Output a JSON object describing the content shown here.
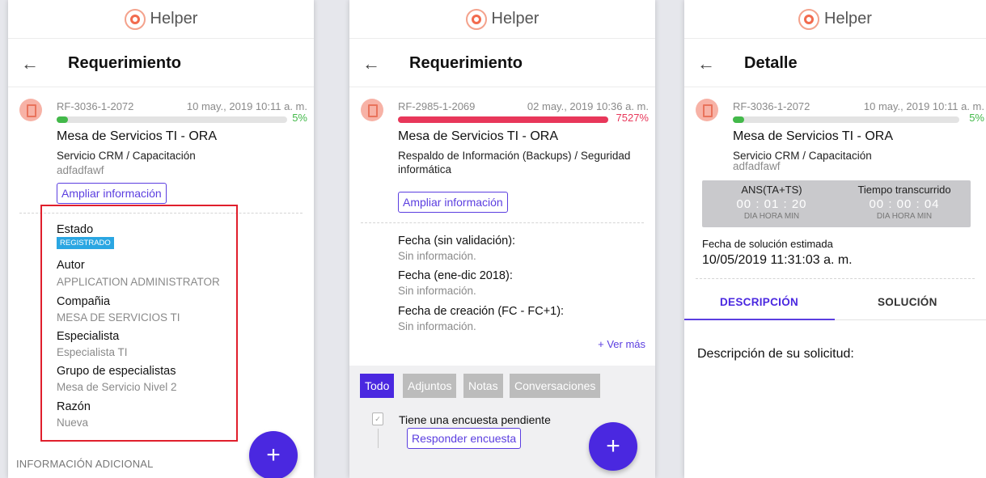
{
  "app": {
    "name": "Helper"
  },
  "colors": {
    "accent": "#4a28e0",
    "progress_green": "#43b94a",
    "progress_red": "#e8375a",
    "badge_blue": "#2aa6e2",
    "highlight_box": "#e01f2c"
  },
  "screen1": {
    "title": "Requerimiento",
    "request_id": "RF-3036-1-2072",
    "date": "10 may., 2019 10:11 a. m.",
    "progress_percent": 5,
    "progress_label": "5%",
    "service_desk": "Mesa de Servicios TI - ORA",
    "category": "Servicio CRM / Capacitación",
    "description": "adfadfawf",
    "expand_button": "Ampliar información",
    "fields": {
      "estado_label": "Estado",
      "estado_badge": "REGISTRADO",
      "autor_label": "Autor",
      "autor_value": "APPLICATION ADMINISTRATOR",
      "compania_label": "Compañia",
      "compania_value": "MESA DE SERVICIOS TI",
      "especialista_label": "Especialista",
      "especialista_value": "Especialista TI",
      "grupo_label": "Grupo de especialistas",
      "grupo_value": "Mesa de Servicio Nivel 2",
      "razon_label": "Razón",
      "razon_value": "Nueva"
    },
    "additional_info": "INFORMACIÓN ADICIONAL",
    "fab": "+"
  },
  "screen2": {
    "title": "Requerimiento",
    "request_id": "RF-2985-1-2069",
    "date": "02 may., 2019 10:36 a. m.",
    "progress_percent": 100,
    "progress_label": "7527%",
    "service_desk": "Mesa de Servicios TI - ORA",
    "category": "Respaldo de Información (Backups) / Seguridad informática",
    "expand_button": "Ampliar información",
    "fields": [
      {
        "label": "Fecha (sin validación):",
        "value": "Sin información."
      },
      {
        "label": "Fecha (ene-dic 2018):",
        "value": "Sin información."
      },
      {
        "label": "Fecha de creación (FC - FC+1):",
        "value": "Sin información."
      }
    ],
    "ver_mas": "+ Ver más",
    "tabs": [
      "Todo",
      "Adjuntos",
      "Notas",
      "Conversaciones"
    ],
    "survey_text": "Tiene una encuesta pendiente",
    "survey_button": "Responder encuesta",
    "fab": "+"
  },
  "screen3": {
    "title": "Detalle",
    "request_id": "RF-3036-1-2072",
    "date": "10 may., 2019 10:11 a. m.",
    "progress_percent": 5,
    "progress_label": "5%",
    "service_desk": "Mesa de Servicios TI - ORA",
    "category": "Servicio CRM / Capacitación",
    "description": "adfadfawf",
    "ans_title": "ANS(TA+TS)",
    "ans_time": "00 : 01 : 20",
    "ans_units": "DIA HORA MIN",
    "elapsed_title": "Tiempo transcurrido",
    "elapsed_time": "00 : 00 : 04",
    "elapsed_units": "DIA HORA MIN",
    "solution_date_label": "Fecha de solución estimada",
    "solution_date_value": "10/05/2019 11:31:03 a. m.",
    "tab_descripcion": "DESCRIPCIÓN",
    "tab_solucion": "SOLUCIÓN",
    "description_heading": "Descripción de su solicitud:"
  }
}
